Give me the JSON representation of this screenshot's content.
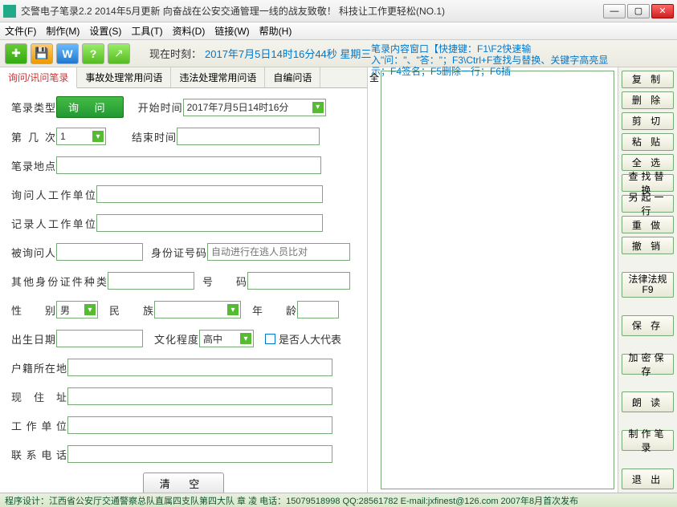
{
  "window": {
    "title": "交警电子笔录2.2 2014年5月更新  向奋战在公安交通管理一线的战友致敬！          科技让工作更轻松(NO.1)"
  },
  "menu": [
    "文件(F)",
    "制作(M)",
    "设置(S)",
    "工具(T)",
    "资料(D)",
    "链接(W)",
    "帮助(H)"
  ],
  "clock": {
    "label": "现在时刻：",
    "value": "2017年7月5日14时16分44秒  星期三"
  },
  "hint": "笔录内容窗口【快捷键：F1\\F2快速输入\"问：\"、\"答：\"；F3\\Ctrl+F查找与替换、关键字高亮显示；F4签名；F5删除一行；F6插",
  "tabs": [
    "询问/讯问笔录",
    "事故处理常用问语",
    "违法处理常用问语",
    "自编问语"
  ],
  "fullchar": "全",
  "form": {
    "type_label": "笔录类型",
    "type_btn": "询  问",
    "start_label": "开始时间",
    "start_val": "2017年7月5日14时16分",
    "count_label": "第 几 次",
    "count_val": "1",
    "end_label": "结束时间",
    "place_label": "笔录地点",
    "asker_unit_label": "询问人工作单位",
    "recorder_unit_label": "记录人工作单位",
    "asked_label": "被询问人",
    "id_label": "身份证号码",
    "id_placeholder": "自动进行在逃人员比对",
    "other_id_label": "其他身份证件种类",
    "numcode_label": "号   码",
    "sex_label": "性   别",
    "sex_val": "男",
    "nation_label": "民   族",
    "age_label": "年   龄",
    "birth_label": "出生日期",
    "edu_label": "文化程度",
    "edu_val": "高中",
    "people_rep_label": "是否人大代表",
    "hukou_label": "户籍所在地",
    "addr_label": "现 住 址",
    "work_label": "工作单位",
    "phone_label": "联系电话",
    "clear_btn": "清  空"
  },
  "rightbtns": {
    "copy": "复  制",
    "delete": "删  除",
    "cut": "剪  切",
    "paste": "粘  贴",
    "selall": "全  选",
    "find": "查找替换",
    "newline": "另起一行",
    "redo": "重  做",
    "undo": "撤  销",
    "law": "法律法规\nF9",
    "save": "保  存",
    "saveenc": "加密保存",
    "read": "朗  读",
    "make": "制作笔录",
    "exit": "退  出"
  },
  "statusbar": "程序设计：江西省公安厅交通警察总队直属四支队第四大队 章 凌  电话：15079518998   QQ:28561782  E-mail:jxfinest@126.com  2007年8月首次发布"
}
